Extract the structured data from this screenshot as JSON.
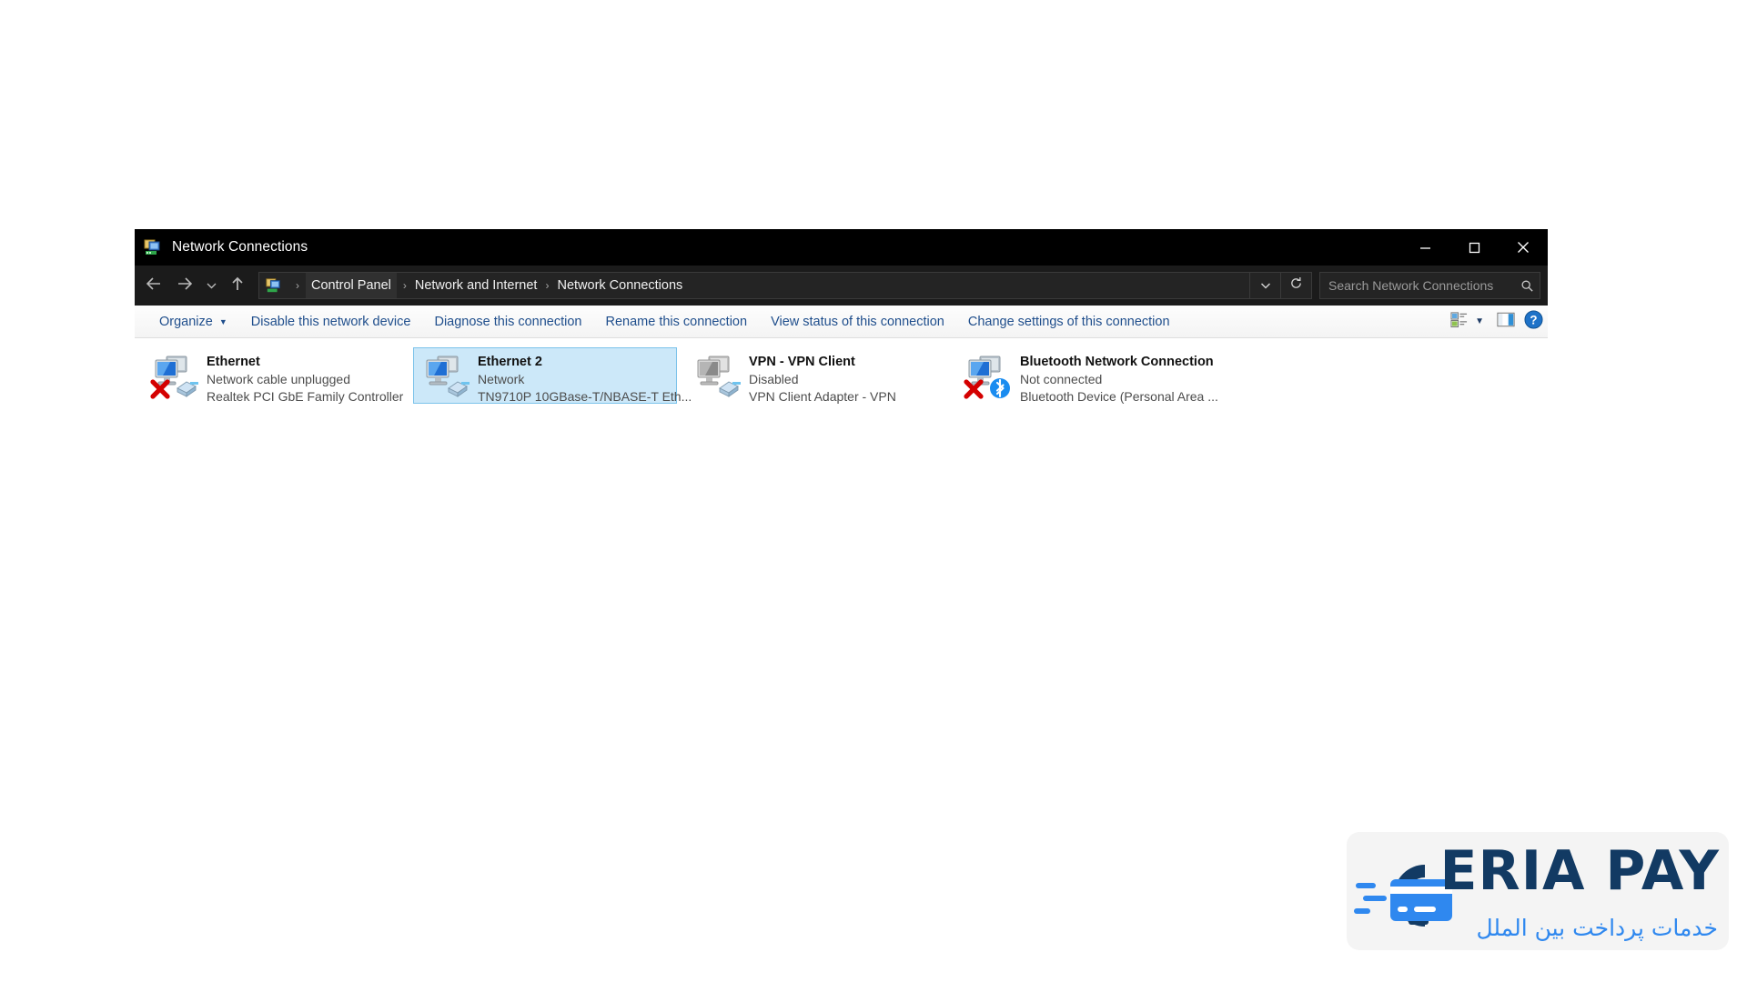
{
  "window": {
    "title": "Network Connections",
    "title_icon": "network-connections-icon",
    "controls": {
      "minimize": "minimize-icon",
      "maximize": "maximize-icon",
      "close": "close-icon"
    }
  },
  "addressbar": {
    "back": "back-arrow-icon",
    "forward": "forward-arrow-icon",
    "recent": "chevron-down-icon",
    "up": "up-arrow-icon",
    "crumb_icon": "control-panel-icon",
    "breadcrumbs": [
      "Control Panel",
      "Network and Internet",
      "Network Connections"
    ],
    "separator": "›",
    "history_chevron": "chevron-down-icon",
    "refresh": "refresh-icon",
    "search": {
      "placeholder": "Search Network Connections",
      "value": "",
      "icon": "search-icon"
    }
  },
  "toolbar": {
    "organize_label": "Organize",
    "organize_caret": "▼",
    "commands": [
      "Disable this network device",
      "Diagnose this connection",
      "Rename this connection",
      "View status of this connection",
      "Change settings of this connection"
    ],
    "view_options_icon": "view-options-icon",
    "view_caret": "▼",
    "preview_pane_icon": "preview-pane-icon",
    "help_icon": "help-icon",
    "link_color": "#1f4e8c"
  },
  "connections": [
    {
      "name": "Ethernet",
      "status": "Network cable unplugged",
      "device": "Realtek PCI GbE Family Controller",
      "selected": false,
      "adapter_state": "enabled",
      "overlay": "red-x",
      "badge": "none"
    },
    {
      "name": "Ethernet 2",
      "status": "Network",
      "device": "TN9710P 10GBase-T/NBASE-T Eth...",
      "selected": true,
      "adapter_state": "enabled",
      "overlay": "none",
      "badge": "none"
    },
    {
      "name": "VPN - VPN Client",
      "status": "Disabled",
      "device": "VPN Client Adapter - VPN",
      "selected": false,
      "adapter_state": "disabled",
      "overlay": "none",
      "badge": "none"
    },
    {
      "name": "Bluetooth Network Connection",
      "status": "Not connected",
      "device": "Bluetooth Device (Personal Area ...",
      "selected": false,
      "adapter_state": "enabled",
      "overlay": "red-x",
      "badge": "bluetooth"
    }
  ],
  "selection_color": "#cce8f9",
  "watermark": {
    "brand": "ERIA PAY",
    "tagline": "خدمات پرداخت بین الملل",
    "mark_icon": "eria-pay-card-icon",
    "brand_color": "#123a63",
    "accent_color": "#2f88ef"
  }
}
